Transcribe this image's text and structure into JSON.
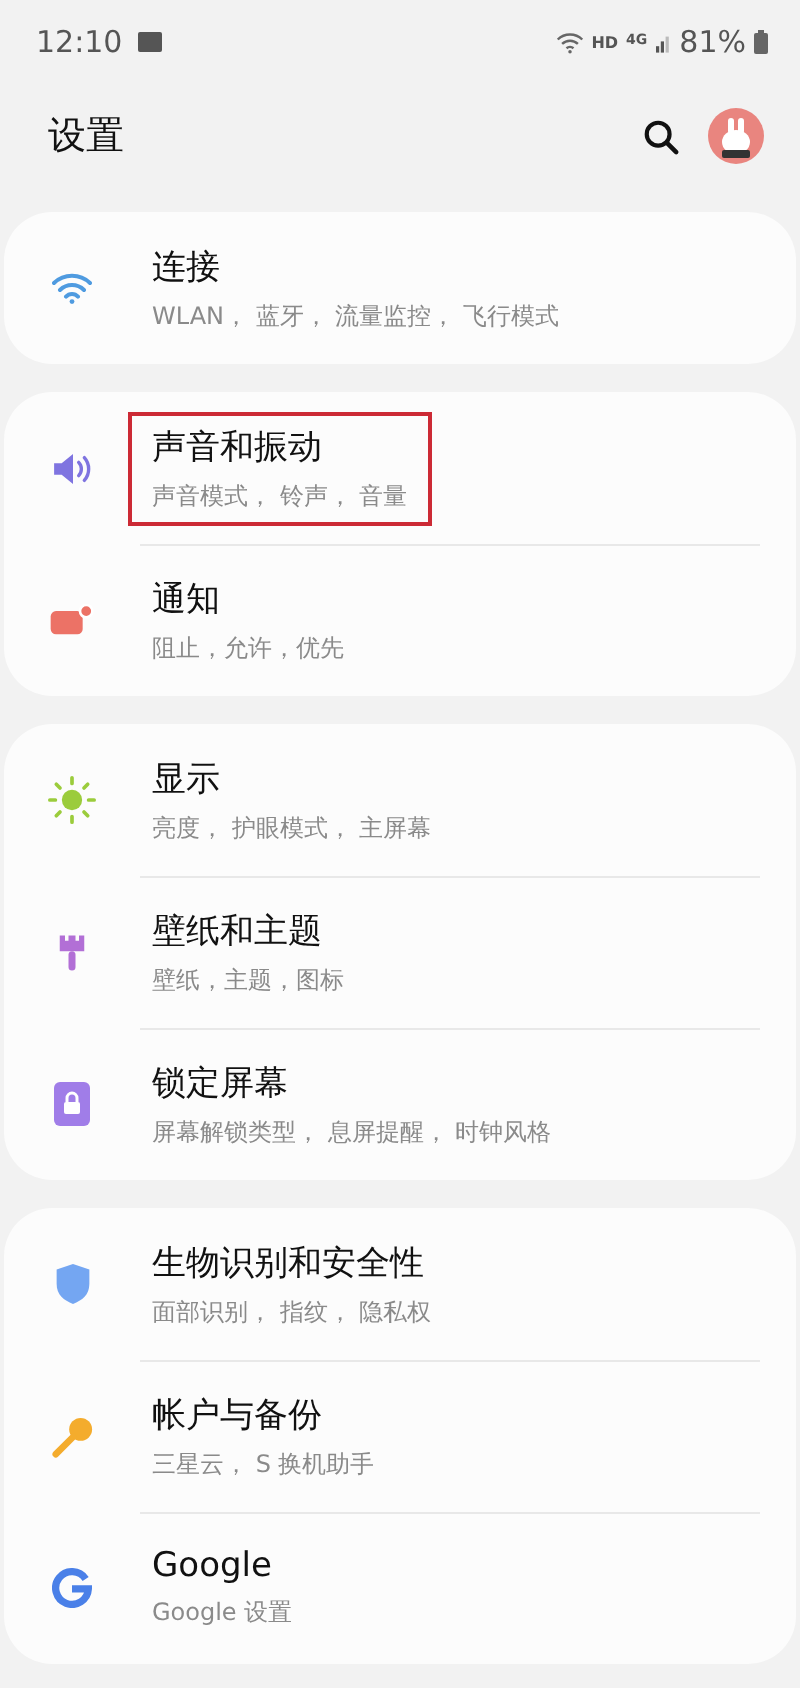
{
  "status_bar": {
    "time": "12:10",
    "network": "HD",
    "network_type": "4G",
    "battery": "81%"
  },
  "header": {
    "title": "设置"
  },
  "groups": [
    {
      "items": [
        {
          "kind": "wifi",
          "title": "连接",
          "subtitle": "WLAN， 蓝牙， 流量监控， 飞行模式",
          "highlighted": false
        }
      ]
    },
    {
      "items": [
        {
          "kind": "sound",
          "title": "声音和振动",
          "subtitle": "声音模式， 铃声， 音量",
          "highlighted": true
        },
        {
          "kind": "notification",
          "title": "通知",
          "subtitle": "阻止，允许，优先",
          "highlighted": false
        }
      ]
    },
    {
      "items": [
        {
          "kind": "display",
          "title": "显示",
          "subtitle": "亮度， 护眼模式， 主屏幕",
          "highlighted": false
        },
        {
          "kind": "wallpaper",
          "title": "壁纸和主题",
          "subtitle": "壁纸，主题，图标",
          "highlighted": false
        },
        {
          "kind": "lock",
          "title": "锁定屏幕",
          "subtitle": "屏幕解锁类型， 息屏提醒， 时钟风格",
          "highlighted": false
        }
      ]
    },
    {
      "items": [
        {
          "kind": "shield",
          "title": "生物识别和安全性",
          "subtitle": "面部识别， 指纹， 隐私权",
          "highlighted": false
        },
        {
          "kind": "key",
          "title": "帐户与备份",
          "subtitle": "三星云， S 换机助手",
          "highlighted": false
        },
        {
          "kind": "google",
          "title": "Google",
          "subtitle": "Google 设置",
          "highlighted": false
        }
      ]
    }
  ]
}
